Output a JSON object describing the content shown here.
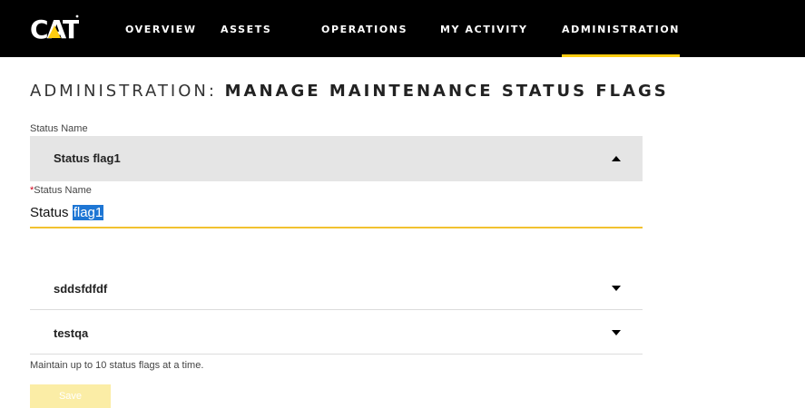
{
  "brand": {
    "logo_text": "CAT"
  },
  "nav": {
    "items": [
      {
        "label": "OVERVIEW"
      },
      {
        "label": "ASSETS"
      },
      {
        "label": "OPERATIONS"
      },
      {
        "label": "MY ACTIVITY"
      },
      {
        "label": "ADMINISTRATION",
        "active": true
      }
    ],
    "accent_color": "#ffcd11"
  },
  "page": {
    "title_lead": "ADMINISTRATION:",
    "title_main": "MANAGE MAINTENANCE STATUS FLAGS"
  },
  "form": {
    "section_label": "Status Name",
    "expanded_flag": {
      "header_name": "Status flag1",
      "field_label": "Status Name",
      "required_marker": "*",
      "value_prefix": "Status ",
      "value_selected": "flag1"
    },
    "other_flags": [
      {
        "name": "sddsfdfdf"
      },
      {
        "name": "testqa"
      }
    ],
    "helper_text": "Maintain up to 10 status flags at a time.",
    "save_label": "Save"
  }
}
